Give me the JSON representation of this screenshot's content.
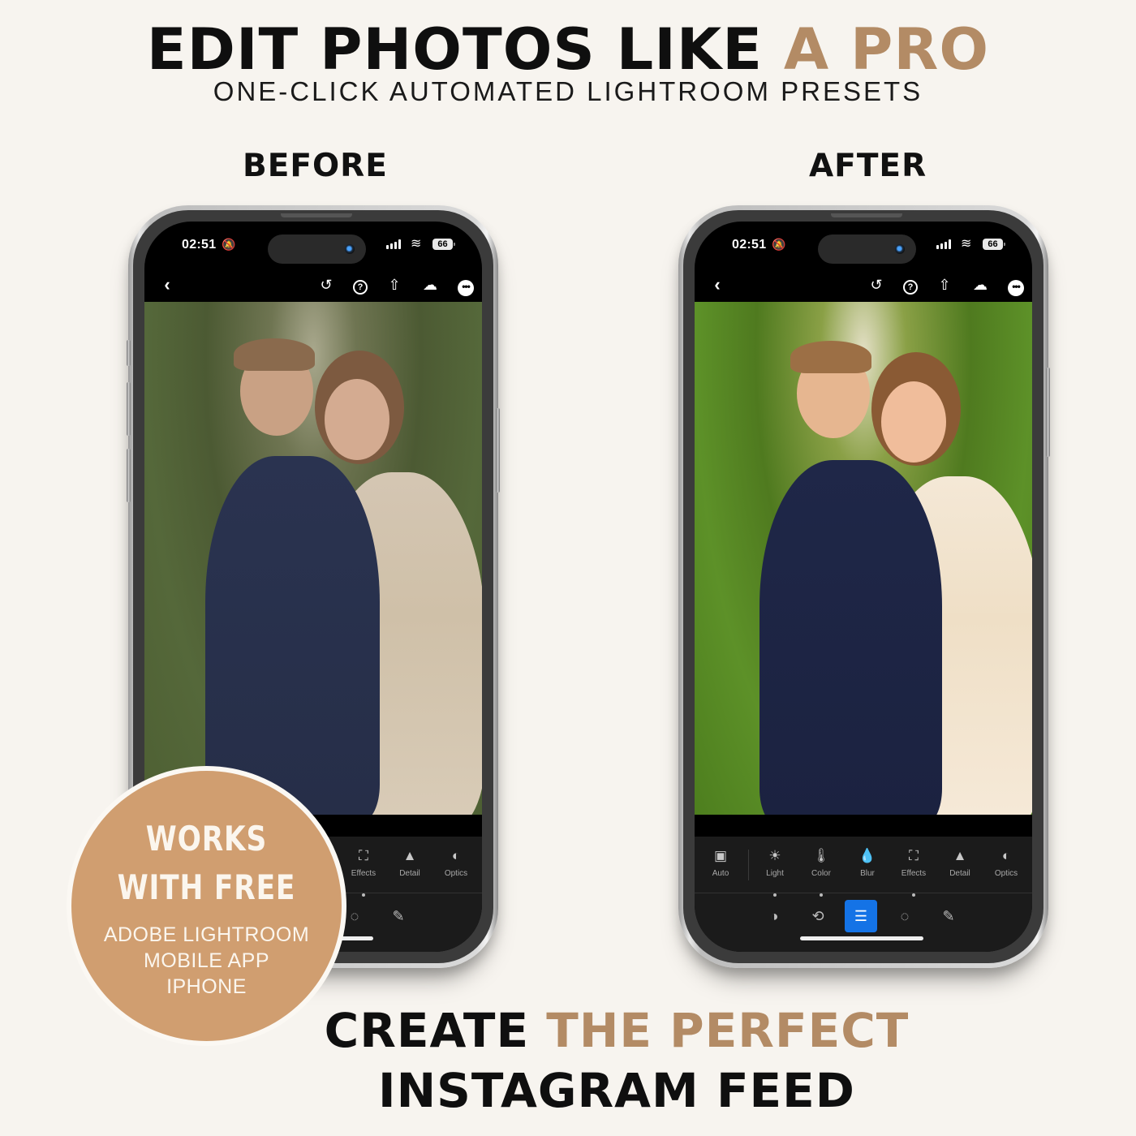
{
  "header": {
    "headline_main": "EDIT PHOTOS LIKE ",
    "headline_accent": "A PRO",
    "subheadline": "ONE-CLICK AUTOMATED LIGHTROOM PRESETS"
  },
  "labels": {
    "before": "BEFORE",
    "after": "AFTER"
  },
  "colors": {
    "accent": "#b38b65",
    "badge": "#d09e70",
    "background": "#f7f4ef",
    "active_tool": "#1473e6"
  },
  "phone": {
    "status_bar": {
      "time": "02:51",
      "bell_icon": "bell-slash-icon",
      "battery": "66"
    },
    "toolbar": {
      "back": "‹",
      "history_icon": "↺",
      "help_icon": "?",
      "share_icon": "⇧",
      "cloud_icon": "☁",
      "more_icon": "•••"
    },
    "tools": [
      {
        "label": "Auto",
        "icon": "▣"
      },
      {
        "label": "Light",
        "icon": "☀"
      },
      {
        "label": "Color",
        "icon": "🌡"
      },
      {
        "label": "Blur",
        "icon": "💧"
      },
      {
        "label": "Effects",
        "icon": "⛶"
      },
      {
        "label": "Detail",
        "icon": "▲"
      },
      {
        "label": "Optics",
        "icon": "◐"
      }
    ],
    "modes": [
      {
        "name": "masking",
        "icon": "◑"
      },
      {
        "name": "crop",
        "icon": "⟲"
      },
      {
        "name": "edit",
        "icon": "☰"
      },
      {
        "name": "vignette-select",
        "icon": "◌"
      },
      {
        "name": "healing",
        "icon": "✎"
      }
    ]
  },
  "badge": {
    "line1": "WORKS",
    "line2": "WITH FREE",
    "line3": "ADOBE LIGHTROOM",
    "line4": "MOBILE APP",
    "line5": "IPHONE"
  },
  "footer": {
    "line1_main": "CREATE ",
    "line1_accent": "THE PERFECT",
    "line2": "INSTAGRAM FEED"
  }
}
